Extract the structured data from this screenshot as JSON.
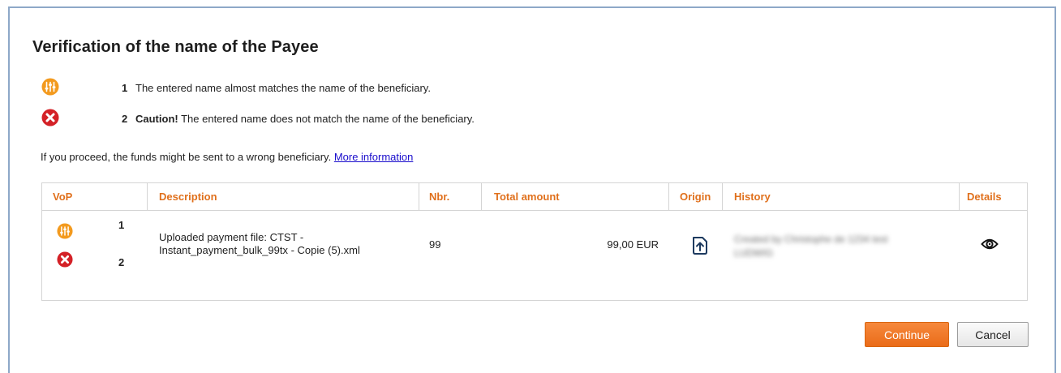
{
  "dialog": {
    "title": "Verification of the name of the Payee"
  },
  "legend": [
    {
      "icon": "partial-match-icon",
      "number": "1",
      "bold": "",
      "text": "The entered name almost matches the name of the beneficiary.",
      "color": "#f39a1e"
    },
    {
      "icon": "no-match-icon",
      "number": "2",
      "bold": "Caution!",
      "text": " The entered name does not match the name of the beneficiary.",
      "color": "#d42127"
    }
  ],
  "warning": {
    "text": "If you proceed, the funds might be sent to a wrong beneficiary. ",
    "link": "More information"
  },
  "table": {
    "headers": {
      "vop": "VoP",
      "description": "Description",
      "nbr": "Nbr.",
      "total_amount": "Total amount",
      "origin": "Origin",
      "history": "History",
      "details": "Details"
    },
    "rows": [
      {
        "vop_counts": [
          "1",
          "2"
        ],
        "description_line1": "Uploaded payment file: CTST -",
        "description_line2": "Instant_payment_bulk_99tx - Copie (5).xml",
        "nbr": "99",
        "total_amount": "99,00 EUR",
        "origin_icon": "upload-file-icon",
        "history_line1": "Created by Christophe de 1234 test",
        "history_line2": "LUDWIG",
        "details_icon": "eye-icon"
      }
    ]
  },
  "buttons": {
    "continue": "Continue",
    "cancel": "Cancel"
  },
  "colors": {
    "accent": "#e0701c",
    "warning_orange": "#f39a1e",
    "error_red": "#d42127",
    "link_blue": "#1a0dcc"
  }
}
